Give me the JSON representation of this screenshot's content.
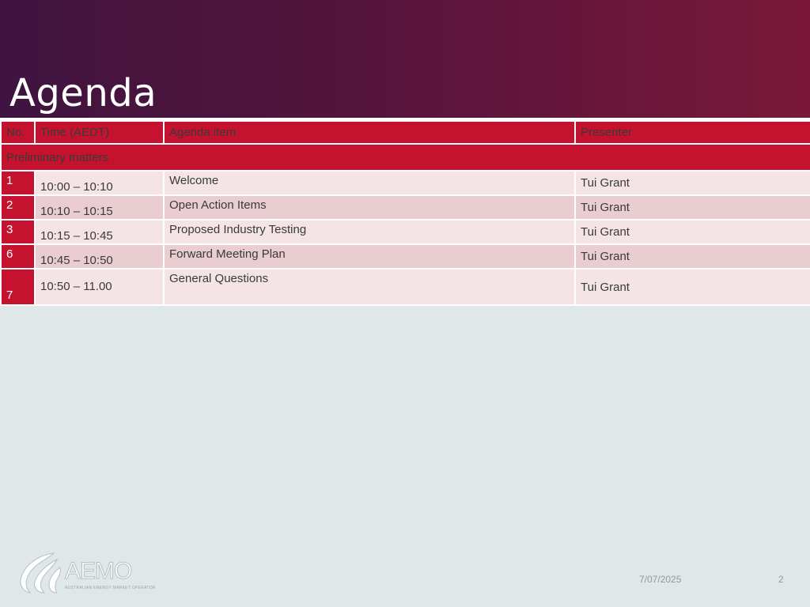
{
  "slide": {
    "title": "Agenda",
    "date": "7/07/2025",
    "page_number": "2"
  },
  "table": {
    "headers": [
      "No.",
      "Time (AEDT)",
      "Agenda item",
      "Presenter"
    ],
    "section": "Preliminary matters",
    "rows": [
      {
        "no": "1",
        "time": "10:00 – 10:10",
        "item": "Welcome",
        "presenter": "Tui Grant"
      },
      {
        "no": "2",
        "time": "10:10 – 10:15",
        "item": "Open Action Items",
        "presenter": "Tui Grant"
      },
      {
        "no": "3",
        "time": "10:15 – 10:45",
        "item": "Proposed Industry Testing",
        "presenter": "Tui Grant"
      },
      {
        "no": "6",
        "time": "10:45 – 10:50",
        "item": "Forward Meeting Plan",
        "presenter": "Tui Grant"
      },
      {
        "no": "7",
        "time": "10:50 – 11.00",
        "item": "General Questions",
        "presenter": "Tui Grant"
      }
    ]
  },
  "logo": {
    "word": "AEMO",
    "subtitle": "AUSTRALIAN ENERGY MARKET OPERATOR"
  },
  "colors": {
    "accent": "#c4122f",
    "header_start": "#3f1440",
    "header_end": "#7a1838",
    "row_light": "#f4e4e5",
    "row_alt": "#e9cdd0",
    "background": "#dfe7e9"
  }
}
